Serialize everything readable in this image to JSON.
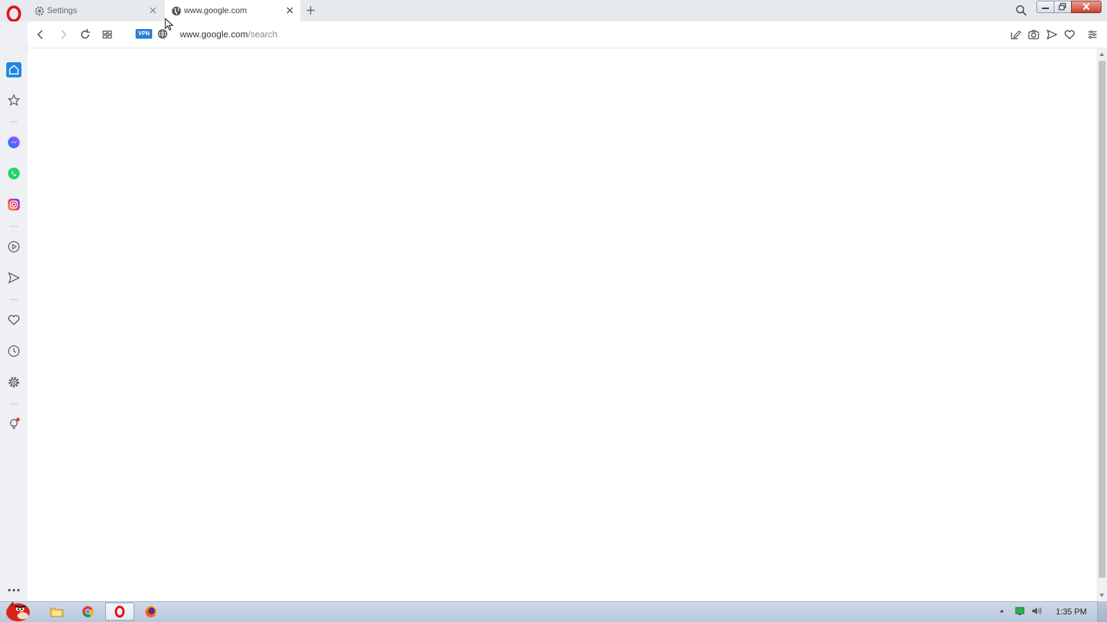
{
  "tabs": [
    {
      "label": "Settings",
      "icon": "gear-icon",
      "active": false
    },
    {
      "label": "www.google.com",
      "icon": "globe-icon",
      "active": true
    }
  ],
  "address_bar": {
    "vpn_label": "VPN",
    "url_host": "www.google.com",
    "url_path": "/search"
  },
  "sidebar": {
    "items": [
      "home-icon",
      "bookmarks-star-icon",
      "messenger-icon",
      "whatsapp-icon",
      "instagram-icon",
      "player-icon",
      "flow-send-icon",
      "favorites-heart-icon",
      "history-clock-icon",
      "settings-gear-icon",
      "tips-bulb-icon",
      "more-dots-icon"
    ]
  },
  "taskbar": {
    "clock": "1:35 PM"
  },
  "colors": {
    "opera_red": "#e0131d",
    "accent_blue": "#1e88e5",
    "vpn_blue": "#2a7fd4"
  }
}
